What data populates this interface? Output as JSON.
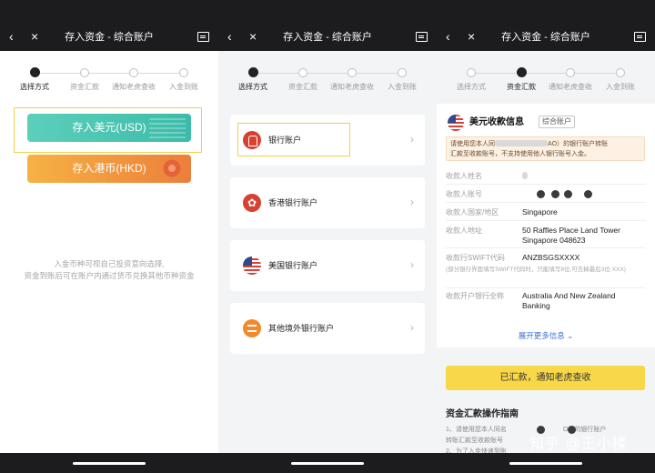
{
  "app": {
    "title": "存入资金 - 综合账户"
  },
  "steps": [
    "选择方式",
    "资金汇款",
    "通知老虎查收",
    "入金到账"
  ],
  "panel1": {
    "usd_button": "存入美元(USD)",
    "hkd_button": "存入港币(HKD)",
    "note_line1": "入金币种可视自己投资意向选择,",
    "note_line2": "资金到账后可在账户内通过货币兑换其他币种资金"
  },
  "panel2": {
    "options": [
      {
        "label": "银行账户",
        "icon": "bank-icon"
      },
      {
        "label": "香港银行账户",
        "icon": "hk-flag-icon"
      },
      {
        "label": "美国银行账户",
        "icon": "us-flag-icon"
      },
      {
        "label": "其他境外银行账户",
        "icon": "building-icon"
      }
    ],
    "chevron": "›"
  },
  "panel3": {
    "title": "美元收款信息",
    "tag": "综合账户",
    "warning_line1": "请使用您本人同",
    "warning_line1b": "AO）的银行账户转账",
    "warning_line2": "汇款至收款账号，不支持使用他人银行账号入金。",
    "fields": [
      {
        "key": "收款人姓名",
        "value": ""
      },
      {
        "key": "收款人账号",
        "value": ""
      },
      {
        "key": "收款人国家/地区",
        "value": "Singapore"
      },
      {
        "key": "收款人地址",
        "value": "50 Raffles Place Land Tower Singapore 048623"
      },
      {
        "key": "收款行SWIFT代码",
        "value": "ANZBSGSXXXX"
      }
    ],
    "swift_note": "(部分银行界面填写SWIFT代码时，只能填写8位,可去掉最后3位 XXX)",
    "bank_name_key": "收款开户银行全称",
    "bank_name_value": "Australia And New Zealand Banking",
    "more": "展开更多信息",
    "more_chevron": "⌄",
    "confirm_button": "已汇款，通知老虎查收",
    "guide_title": "资金汇款操作指南",
    "guide_line1a": "1、请使用您本人同名",
    "guide_line1b": "O）的银行账户",
    "guide_line2": "转账汇款至收款账号",
    "guide_line3": "2、为了入金快速到账"
  },
  "nav_icons": {
    "back": "‹",
    "close": "×"
  },
  "watermark": "知乎 @王小楼",
  "colors": {
    "accent_yellow": "#f8d749",
    "usd_teal": "#3bbca8",
    "hkd_orange": "#ec7e3b",
    "highlight_border": "#f2d24a",
    "link_blue": "#3a6fd8"
  }
}
